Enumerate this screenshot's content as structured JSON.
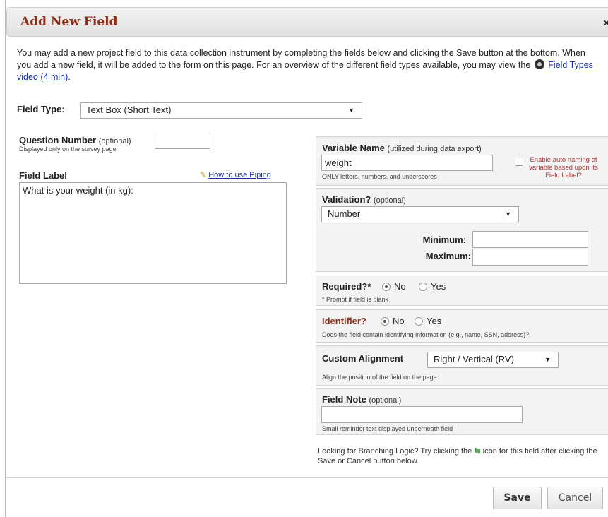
{
  "dialog": {
    "title": "Add New Field",
    "close": "×"
  },
  "intro": {
    "text_before": "You may add a new project field to this data collection instrument by completing the fields below and clicking the Save button at the bottom. When you add a new field, it will be added to the form on this page. For an overview of the different field types available, you may view the",
    "video_link": "Field Types video (4 min)",
    "text_after": "."
  },
  "field_type": {
    "label": "Field Type:",
    "selected": "Text Box (Short Text)"
  },
  "question_number": {
    "label": "Question Number",
    "optional": "(optional)",
    "help": "Displayed only on the survey page",
    "value": ""
  },
  "field_label": {
    "label": "Field Label",
    "piping_link": "How to use Piping",
    "value": "What is your weight (in kg):"
  },
  "variable_name": {
    "label": "Variable Name",
    "note": "(utilized during data export)",
    "value": "weight",
    "help": "ONLY letters, numbers, and underscores",
    "auto_naming": "Enable auto naming of variable based upon its Field Label?"
  },
  "validation": {
    "label": "Validation?",
    "optional": "(optional)",
    "selected": "Number",
    "minimum_label": "Minimum:",
    "maximum_label": "Maximum:",
    "minimum_value": "",
    "maximum_value": ""
  },
  "required": {
    "label": "Required?*",
    "no": "No",
    "yes": "Yes",
    "help": "* Prompt if field is blank"
  },
  "identifier": {
    "label": "Identifier?",
    "no": "No",
    "yes": "Yes",
    "help": "Does the field contain identifying information (e.g., name, SSN, address)?"
  },
  "alignment": {
    "label": "Custom Alignment",
    "selected": "Right / Vertical (RV)",
    "help": "Align the position of the field on the page"
  },
  "field_note": {
    "label": "Field Note",
    "optional": "(optional)",
    "value": "",
    "help": "Small reminder text displayed underneath field"
  },
  "branching": {
    "text_before": "Looking for Branching Logic? Try clicking the",
    "text_after": "icon for this field after clicking the Save or Cancel button below."
  },
  "buttons": {
    "save": "Save",
    "cancel": "Cancel"
  },
  "colors": {
    "title": "#8b2f1a",
    "identifier": "#8b2f1a",
    "link": "#1a2fa7",
    "auto_naming": "#a83a3a"
  }
}
